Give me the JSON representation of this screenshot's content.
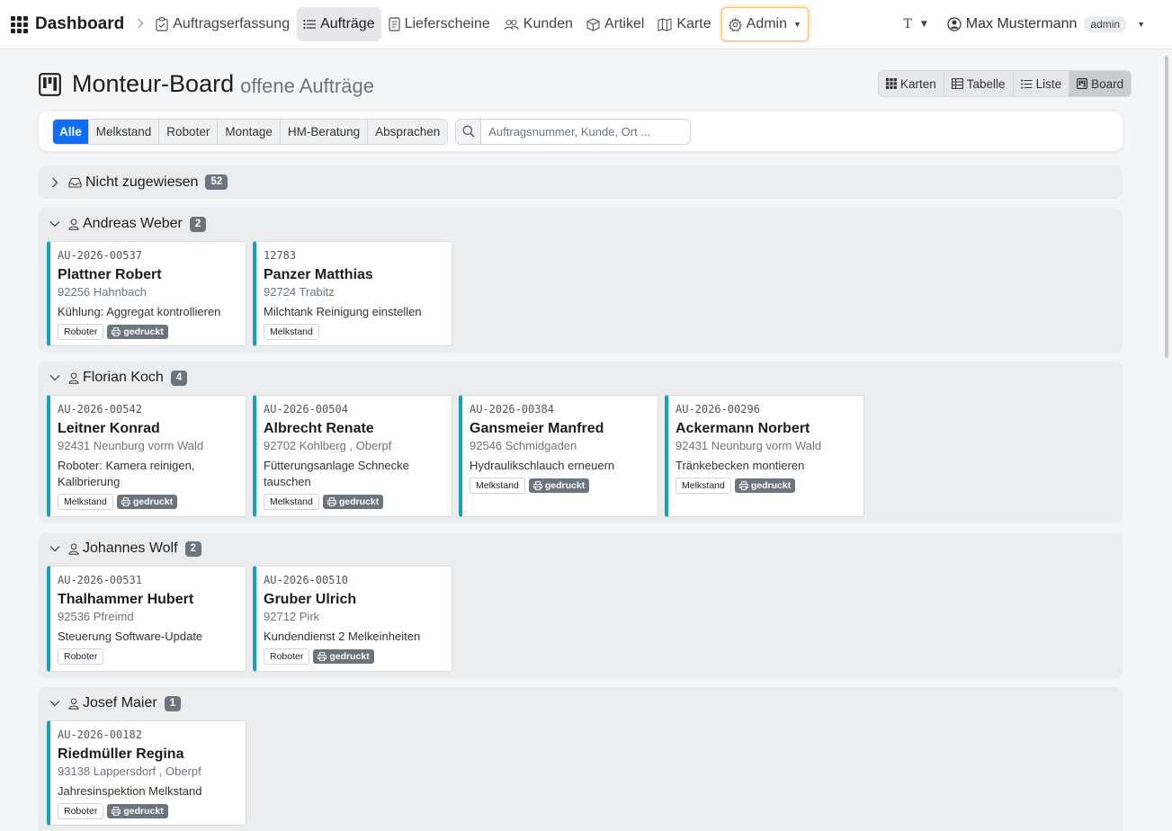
{
  "nav": {
    "brand": "Dashboard",
    "items": [
      {
        "label": "Auftragserfassung",
        "icon": "clipboard-icon"
      },
      {
        "label": "Aufträge",
        "icon": "list-icon"
      },
      {
        "label": "Lieferscheine",
        "icon": "document-icon"
      },
      {
        "label": "Kunden",
        "icon": "people-icon"
      },
      {
        "label": "Artikel",
        "icon": "box-icon"
      },
      {
        "label": "Karte",
        "icon": "map-icon"
      },
      {
        "label": "Admin",
        "icon": "gear-icon"
      }
    ],
    "font_toggle": "T",
    "user_name": "Max Mustermann",
    "user_role": "admin"
  },
  "header": {
    "title": "Monteur-Board",
    "subtitle": "offene Aufträge",
    "views": [
      "Karten",
      "Tabelle",
      "Liste",
      "Board"
    ],
    "active_view": "Board"
  },
  "filters": {
    "buttons": [
      "Alle",
      "Melkstand",
      "Roboter",
      "Montage",
      "HM-Beratung",
      "Absprachen"
    ],
    "search_placeholder": "Auftragsnummer, Kunde, Ort ..."
  },
  "colors": {
    "accent": "#0d6efd",
    "card_stripe": "#17a2b8",
    "badge": "#6c757d"
  },
  "printed_label": "gedruckt",
  "groups": [
    {
      "name": "Nicht zugewiesen",
      "count": "52",
      "collapsed": true,
      "cards": []
    },
    {
      "name": "Andreas Weber",
      "count": "2",
      "collapsed": false,
      "cards": [
        {
          "no": "AU-2026-00537",
          "name": "Plattner Robert",
          "loc": "92256 Hahnbach",
          "task": "Kühlung: Aggregat kontrollieren",
          "tag": "Roboter",
          "printed": true
        },
        {
          "no": "12783",
          "name": "Panzer Matthias",
          "loc": "92724 Trabitz",
          "task": "Milchtank Reinigung einstellen",
          "tag": "Melkstand",
          "printed": false
        }
      ]
    },
    {
      "name": "Florian Koch",
      "count": "4",
      "collapsed": false,
      "cards": [
        {
          "no": "AU-2026-00542",
          "name": "Leitner Konrad",
          "loc": "92431 Neunburg vorm Wald",
          "task": "Roboter: Kamera reinigen, Kalibrierung",
          "tag": "Melkstand",
          "printed": true
        },
        {
          "no": "AU-2026-00504",
          "name": "Albrecht Renate",
          "loc": "92702 Kohlberg , Oberpf",
          "task": "Fütterungsanlage Schnecke tauschen",
          "tag": "Melkstand",
          "printed": true
        },
        {
          "no": "AU-2026-00384",
          "name": "Gansmeier Manfred",
          "loc": "92546 Schmidgaden",
          "task": "Hydraulikschlauch erneuern",
          "tag": "Melkstand",
          "printed": true
        },
        {
          "no": "AU-2026-00296",
          "name": "Ackermann Norbert",
          "loc": "92431 Neunburg vorm Wald",
          "task": "Tränkebecken montieren",
          "tag": "Melkstand",
          "printed": true
        }
      ]
    },
    {
      "name": "Johannes Wolf",
      "count": "2",
      "collapsed": false,
      "cards": [
        {
          "no": "AU-2026-00531",
          "name": "Thalhammer Hubert",
          "loc": "92536 Pfreimd",
          "task": "Steuerung Software-Update",
          "tag": "Roboter",
          "printed": false
        },
        {
          "no": "AU-2026-00510",
          "name": "Gruber Ulrich",
          "loc": "92712 Pirk",
          "task": "Kundendienst 2 Melkeinheiten",
          "tag": "Roboter",
          "printed": true
        }
      ]
    },
    {
      "name": "Josef Maier",
      "count": "1",
      "collapsed": false,
      "cards": [
        {
          "no": "AU-2026-00182",
          "name": "Riedmüller Regina",
          "loc": "93138 Lappersdorf , Oberpf",
          "task": "Jahresinspektion Melkstand",
          "tag": "Roboter",
          "printed": true
        }
      ]
    }
  ]
}
